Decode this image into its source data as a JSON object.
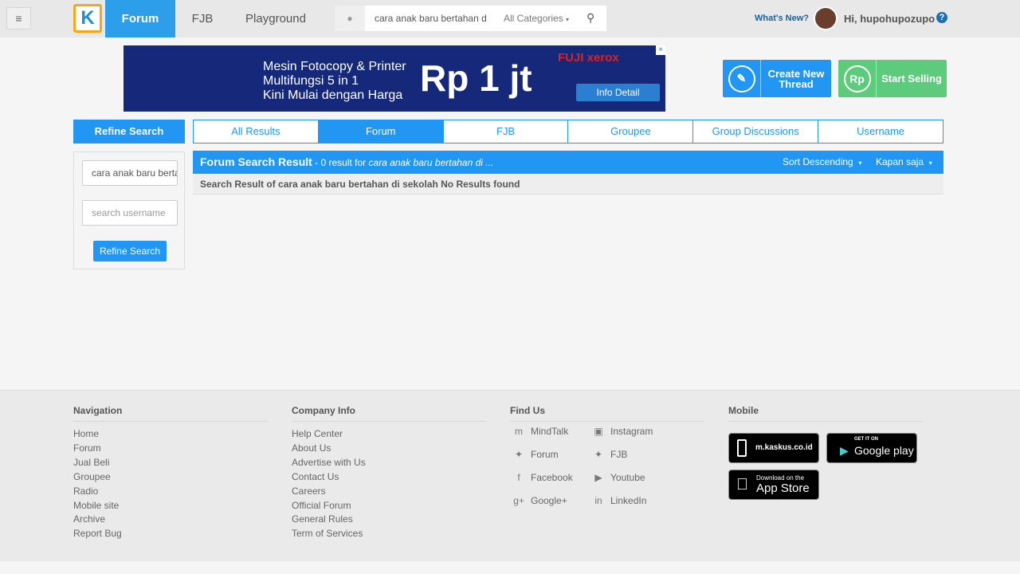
{
  "header": {
    "menu_icon": "hamburger-icon",
    "logo": "K",
    "nav": [
      "Forum",
      "FJB",
      "Playground"
    ],
    "search_query": "cara anak baru bertahan di sekolah",
    "category": "All Categories",
    "whats_new": "What's New?",
    "greeting": "Hi, hupohupozupo",
    "help": "?"
  },
  "ad": {
    "line1": "Mesin Fotocopy & Printer",
    "line2": "Multifungsi 5 in 1",
    "line3": "Kini Mulai dengan Harga",
    "price": "Rp 1 jt",
    "brand": "FUJI xerox",
    "cta": "Info Detail"
  },
  "actions": {
    "create": "Create New Thread",
    "sell": "Start Selling",
    "rp": "Rp"
  },
  "refine": {
    "title": "Refine Search",
    "query": "cara anak baru bertahan di sekolah",
    "username_placeholder": "search username",
    "button": "Refine Search"
  },
  "tabs": [
    "All Results",
    "Forum",
    "FJB",
    "Groupee",
    "Group Discussions",
    "Username"
  ],
  "results": {
    "title": "Forum Search Result",
    "count_text": " - 0 result for ",
    "query_short": "cara anak baru bertahan di ...",
    "sort": "Sort Descending",
    "time": "Kapan saja",
    "message": "Search Result of cara anak baru bertahan di sekolah No Results found"
  },
  "footer": {
    "navigation": {
      "title": "Navigation",
      "items": [
        "Home",
        "Forum",
        "Jual Beli",
        "Groupee",
        "Radio",
        "Mobile site",
        "Archive",
        "Report Bug"
      ]
    },
    "company": {
      "title": "Company Info",
      "items": [
        "Help Center",
        "About Us",
        "Advertise with Us",
        "Contact Us",
        "Careers",
        "Official Forum",
        "General Rules",
        "Term of Services"
      ]
    },
    "find": {
      "title": "Find Us",
      "items": [
        "MindTalk",
        "Instagram",
        "Forum",
        "FJB",
        "Facebook",
        "Youtube",
        "Google+",
        "LinkedIn"
      ]
    },
    "mobile": {
      "title": "Mobile",
      "site": "m.kaskus.co.id",
      "gp_small": "GET IT ON",
      "gp_big": "Google play",
      "as_small": "Download on the",
      "as_big": "App Store"
    }
  }
}
